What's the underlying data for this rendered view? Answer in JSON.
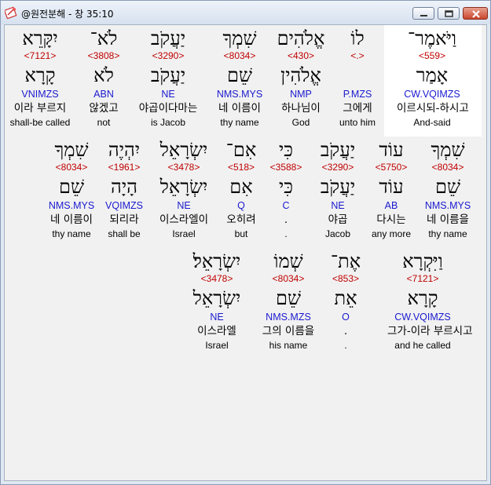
{
  "window": {
    "title": "@원전분해 - 창 35:10"
  },
  "rows": [
    {
      "words": [
        {
          "hebrew": "יִקָּרֵא",
          "number": "<7121>",
          "root": "קָרָא",
          "morph": "VNIMZS",
          "korean": "이라 부르지",
          "english": "shall-be called"
        },
        {
          "hebrew": "לֹא־",
          "number": "<3808>",
          "root": "לֹא",
          "morph": "ABN",
          "korean": "않겠고",
          "english": "not"
        },
        {
          "hebrew": "יַעֲקֹב",
          "number": "<3290>",
          "root": "יַעֲקֹב",
          "morph": "NE",
          "korean": "야곱이다마는",
          "english": "is Jacob"
        },
        {
          "hebrew": "שִׁמְךָ",
          "number": "<8034>",
          "root": "שֵׁם",
          "morph": "NMS.MYS",
          "korean": "네 이름이",
          "english": "thy name"
        },
        {
          "hebrew": "אֱלֹהִים",
          "number": "<430>",
          "root": "אֱלֹהִין",
          "morph": "NMP",
          "korean": "하나님이",
          "english": "God"
        },
        {
          "hebrew": "לוֹ",
          "number": "<.>",
          "root": "",
          "morph": "P.MZS",
          "korean": "그에게",
          "english": "unto him"
        },
        {
          "hebrew": "וַיֹּאמֶר־",
          "number": "<559>",
          "root": "אָמַר",
          "morph": "CW.VQIMZS",
          "korean": "이르시되-하시고",
          "english": "And-said"
        }
      ]
    },
    {
      "words": [
        {
          "hebrew": "שִׁמְךָ",
          "number": "<8034>",
          "root": "שֵׁם",
          "morph": "NMS.MYS",
          "korean": "네 이름이",
          "english": "thy name"
        },
        {
          "hebrew": "יִהְיֶה",
          "number": "<1961>",
          "root": "הָיָה",
          "morph": "VQIMZS",
          "korean": "되리라",
          "english": "shall be"
        },
        {
          "hebrew": "יִשְׂרָאֵל",
          "number": "<3478>",
          "root": "יִשְׂרָאֵל",
          "morph": "NE",
          "korean": "이스라엘이",
          "english": "Israel"
        },
        {
          "hebrew": "אִם־",
          "number": "<518>",
          "root": "אִם",
          "morph": "Q",
          "korean": "오히려",
          "english": "but"
        },
        {
          "hebrew": "כִּי",
          "number": "<3588>",
          "root": "כִּי",
          "morph": "C",
          "korean": ".",
          "english": "."
        },
        {
          "hebrew": "יַעֲקֹב",
          "number": "<3290>",
          "root": "יַעֲקֹב",
          "morph": "NE",
          "korean": "야곱",
          "english": "Jacob"
        },
        {
          "hebrew": "עוֹד",
          "number": "<5750>",
          "root": "עוֹד",
          "morph": "AB",
          "korean": "다시는",
          "english": "any more"
        },
        {
          "hebrew": "שִׁמְךָ",
          "number": "<8034>",
          "root": "שֵׁם",
          "morph": "NMS.MYS",
          "korean": "네 이름을",
          "english": "thy name"
        }
      ]
    },
    {
      "words": [
        {
          "hebrew": "יִשְׂרָאֵל׃",
          "number": "<3478>",
          "root": "יִשְׂרָאֵל",
          "morph": "NE",
          "korean": "이스라엘",
          "english": "Israel"
        },
        {
          "hebrew": "שְׁמוֹ",
          "number": "<8034>",
          "root": "שֵׁם",
          "morph": "NMS.MZS",
          "korean": "그의 이름을",
          "english": "his name"
        },
        {
          "hebrew": "אֶת־",
          "number": "<853>",
          "root": "אֵת",
          "morph": "O",
          "korean": ".",
          "english": "."
        },
        {
          "hebrew": "וַיִּקְרָא",
          "number": "<7121>",
          "root": "קָרָא",
          "morph": "CW.VQIMZS",
          "korean": "그가-이라 부르시고",
          "english": "and he called"
        }
      ]
    }
  ]
}
